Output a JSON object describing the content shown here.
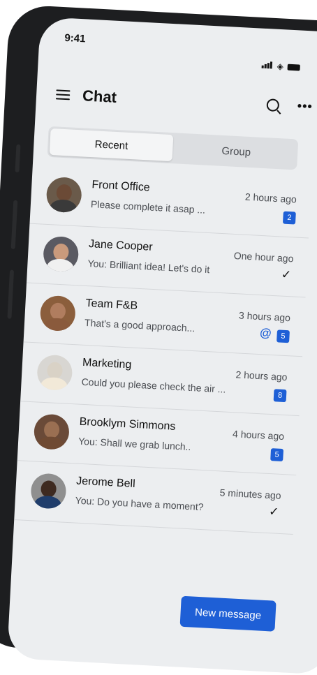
{
  "status_bar": {
    "time": "9:41"
  },
  "header": {
    "title": "Chat"
  },
  "tabs": [
    {
      "label": "Recent",
      "active": true
    },
    {
      "label": "Group",
      "active": false
    }
  ],
  "chats": [
    {
      "name": "Front Office",
      "preview": "Please complete it asap ...",
      "time": "2 hours ago",
      "badge": "2",
      "mention": false,
      "read": false
    },
    {
      "name": "Jane Cooper",
      "preview": "You: Brilliant idea! Let's do it",
      "time": "One hour ago",
      "badge": "",
      "mention": false,
      "read": true
    },
    {
      "name": "Team F&B",
      "preview": "That's a good approach...",
      "time": "3 hours ago",
      "badge": "5",
      "mention": true,
      "read": false
    },
    {
      "name": "Marketing",
      "preview": "Could you please check the air ...",
      "time": "2 hours ago",
      "badge": "8",
      "mention": false,
      "read": false
    },
    {
      "name": "Brooklym Simmons",
      "preview": "You: Shall we grab lunch..",
      "time": "4 hours ago",
      "badge": "5",
      "mention": false,
      "read": false
    },
    {
      "name": "Jerome Bell",
      "preview": "You: Do you have a moment?",
      "time": "5 minutes ago",
      "badge": "",
      "mention": false,
      "read": true
    }
  ],
  "new_message_label": "New message",
  "colors": {
    "accent": "#1e5fd6",
    "background": "#eceef0",
    "frame": "#1d1e20"
  },
  "icons": {
    "menu": "hamburger-icon",
    "search": "search-icon",
    "more": "more-horizontal-icon",
    "mention": "at-sign-icon",
    "read": "check-icon"
  }
}
